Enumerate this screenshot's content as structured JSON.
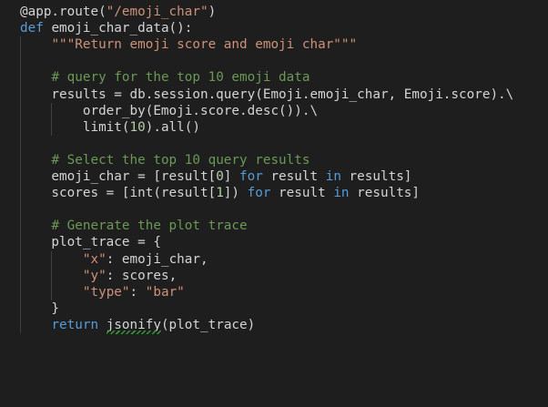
{
  "theme": {
    "background": "#1e1e1e",
    "default": "#d4d4d4",
    "keyword": "#569cd6",
    "string": "#ce9178",
    "comment": "#6a9955",
    "number": "#b5cea8",
    "decorator": "#dcdcaa",
    "lint_squiggle": "#2e9f2e"
  },
  "code": {
    "lines": [
      [
        {
          "t": "@app.route(",
          "c": "default"
        },
        {
          "t": "\"/emoji_char\"",
          "c": "string"
        },
        {
          "t": ")",
          "c": "default"
        }
      ],
      [
        {
          "t": "def ",
          "c": "keyword"
        },
        {
          "t": "emoji_char_data():",
          "c": "default"
        }
      ],
      [
        {
          "t": "    ",
          "c": "default"
        },
        {
          "t": "\"\"\"Return emoji score and emoji char\"\"\"",
          "c": "string"
        }
      ],
      [],
      [
        {
          "t": "    ",
          "c": "default"
        },
        {
          "t": "# query for the top 10 emoji data",
          "c": "comment"
        }
      ],
      [
        {
          "t": "    results = db.session.query(Emoji.emoji_char, Emoji.score).\\",
          "c": "default"
        }
      ],
      [
        {
          "t": "        order_by(Emoji.score.desc()).\\",
          "c": "default"
        }
      ],
      [
        {
          "t": "        limit(",
          "c": "default"
        },
        {
          "t": "10",
          "c": "number"
        },
        {
          "t": ").all()",
          "c": "default"
        }
      ],
      [],
      [
        {
          "t": "    ",
          "c": "default"
        },
        {
          "t": "# Select the top 10 query results",
          "c": "comment"
        }
      ],
      [
        {
          "t": "    emoji_char = [result[",
          "c": "default"
        },
        {
          "t": "0",
          "c": "number"
        },
        {
          "t": "] ",
          "c": "default"
        },
        {
          "t": "for",
          "c": "keyword"
        },
        {
          "t": " result ",
          "c": "default"
        },
        {
          "t": "in",
          "c": "keyword"
        },
        {
          "t": " results]",
          "c": "default"
        }
      ],
      [
        {
          "t": "    scores = [int(result[",
          "c": "default"
        },
        {
          "t": "1",
          "c": "number"
        },
        {
          "t": "]) ",
          "c": "default"
        },
        {
          "t": "for",
          "c": "keyword"
        },
        {
          "t": " result ",
          "c": "default"
        },
        {
          "t": "in",
          "c": "keyword"
        },
        {
          "t": " results]",
          "c": "default"
        }
      ],
      [],
      [
        {
          "t": "    ",
          "c": "default"
        },
        {
          "t": "# Generate the plot trace",
          "c": "comment"
        }
      ],
      [
        {
          "t": "    plot_trace = {",
          "c": "default"
        }
      ],
      [
        {
          "t": "        ",
          "c": "default"
        },
        {
          "t": "\"x\"",
          "c": "string"
        },
        {
          "t": ": emoji_char,",
          "c": "default"
        }
      ],
      [
        {
          "t": "        ",
          "c": "default"
        },
        {
          "t": "\"y\"",
          "c": "string"
        },
        {
          "t": ": scores,",
          "c": "default"
        }
      ],
      [
        {
          "t": "        ",
          "c": "default"
        },
        {
          "t": "\"type\"",
          "c": "string"
        },
        {
          "t": ": ",
          "c": "default"
        },
        {
          "t": "\"bar\"",
          "c": "string"
        }
      ],
      [
        {
          "t": "    }",
          "c": "default"
        }
      ],
      [
        {
          "t": "    ",
          "c": "default"
        },
        {
          "t": "return",
          "c": "keyword"
        },
        {
          "t": " jsonify(plot_trace)",
          "c": "default"
        }
      ]
    ]
  }
}
